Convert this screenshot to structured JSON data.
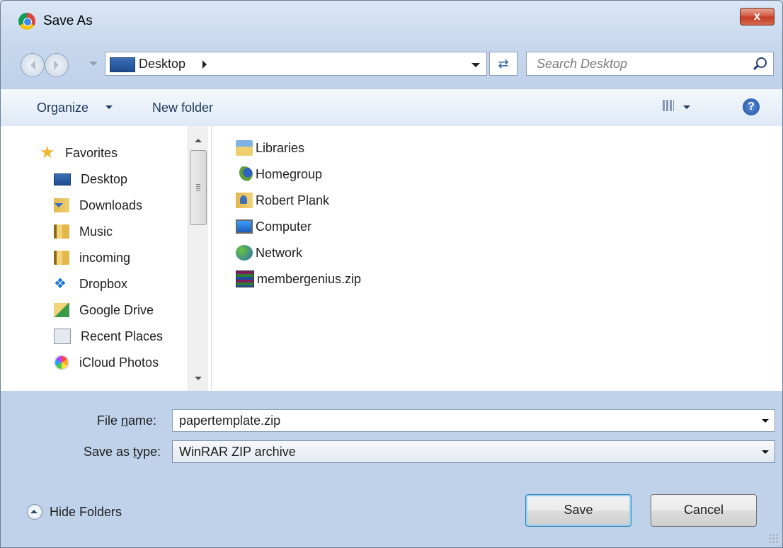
{
  "window": {
    "title": "Save As",
    "close_label": "x"
  },
  "navigation": {
    "address_location": "Desktop",
    "search_placeholder": "Search Desktop"
  },
  "toolbar": {
    "organize_label": "Organize",
    "new_folder_label": "New folder"
  },
  "sidebar": {
    "favorites_label": "Favorites",
    "items": [
      {
        "label": "Desktop",
        "icon": "desktop-icon"
      },
      {
        "label": "Downloads",
        "icon": "downloads-folder-icon"
      },
      {
        "label": "Music",
        "icon": "folder-icon"
      },
      {
        "label": "incoming",
        "icon": "folder-icon"
      },
      {
        "label": "Dropbox",
        "icon": "dropbox-icon"
      },
      {
        "label": "Google Drive",
        "icon": "google-drive-icon"
      },
      {
        "label": "Recent Places",
        "icon": "recent-places-icon"
      },
      {
        "label": "iCloud Photos",
        "icon": "icloud-photos-icon"
      }
    ]
  },
  "files": [
    {
      "label": "Libraries",
      "icon": "libraries-icon"
    },
    {
      "label": "Homegroup",
      "icon": "homegroup-icon"
    },
    {
      "label": "Robert Plank",
      "icon": "user-folder-icon"
    },
    {
      "label": "Computer",
      "icon": "computer-icon"
    },
    {
      "label": "Network",
      "icon": "network-icon"
    },
    {
      "label": "membergenius.zip",
      "icon": "winrar-zip-icon"
    }
  ],
  "form": {
    "filename_label_pre": "File ",
    "filename_label_ul": "n",
    "filename_label_post": "ame:",
    "filename_value": "papertemplate.zip",
    "type_label_pre": "Save as ",
    "type_label_ul": "t",
    "type_label_post": "ype:",
    "type_value": "WinRAR ZIP archive"
  },
  "footer": {
    "hide_folders_label": "Hide Folders",
    "save_label": "Save",
    "cancel_label": "Cancel"
  }
}
